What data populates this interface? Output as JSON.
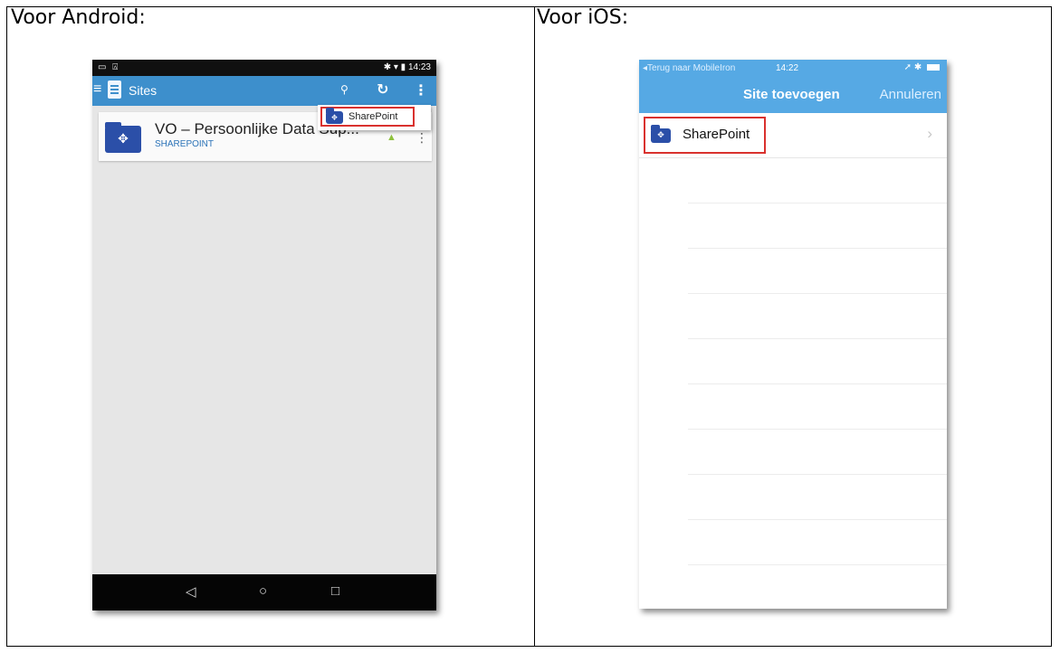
{
  "document": {
    "android_heading": "Voor Android:",
    "ios_heading": "Voor iOS:"
  },
  "android": {
    "status_bar": {
      "left_icons": "▭ ⍓",
      "time": "14:23",
      "icons": "✱ ▾ ▮"
    },
    "app_bar": {
      "title": "Sites",
      "menu_icon": "≡",
      "search_icon": "⚲",
      "refresh_icon": "↻",
      "more_icon": "⋮"
    },
    "site_card": {
      "name": "VO – Persoonlijke Data Sup...",
      "type": "SHAREPOINT",
      "status_icon": "android-icon",
      "more_icon": "⋮"
    },
    "popup_menu": {
      "item_label": "SharePoint",
      "icon": "sharepoint-folder-icon"
    },
    "nav_bar": {
      "back": "◁",
      "home": "○",
      "recents": "□"
    }
  },
  "ios": {
    "status_bar": {
      "back_link": "◂Terug naar MobileIron",
      "time": "14:22",
      "indicators": "➚ ✱"
    },
    "nav_bar": {
      "title": "Site toevoegen",
      "cancel_label": "Annuleren"
    },
    "list": [
      {
        "label": "SharePoint",
        "icon": "sharepoint-folder-icon",
        "chevron": "›"
      }
    ]
  },
  "colors": {
    "android_appbar": "#3d8fcc",
    "ios_navbar": "#56a9e4",
    "highlight_red": "#d9312e",
    "sharepoint_blue": "#2b4fa8"
  }
}
